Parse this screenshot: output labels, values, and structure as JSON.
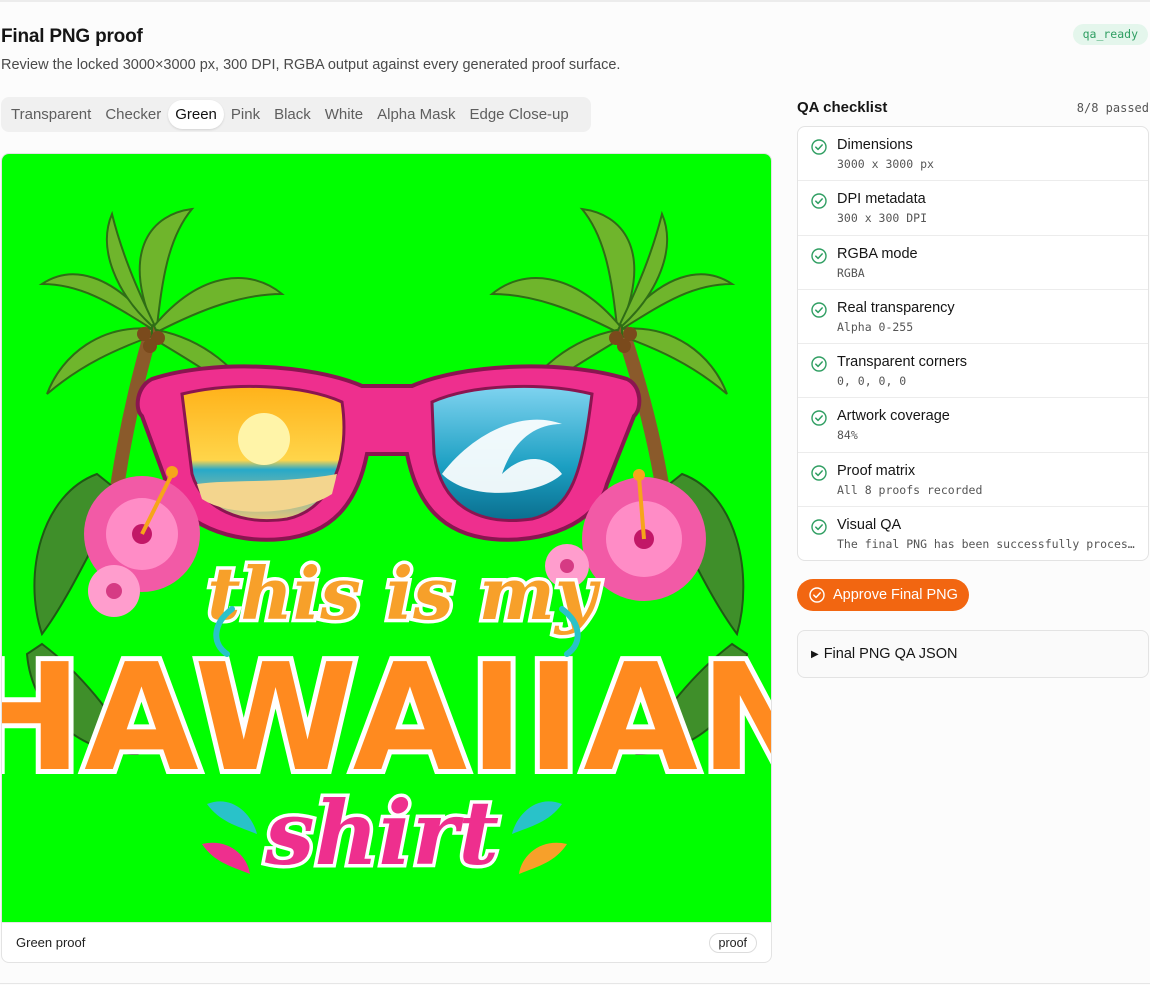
{
  "header": {
    "title": "Final PNG proof",
    "subtitle": "Review the locked 3000×3000 px, 300 DPI, RGBA output against every generated proof surface.",
    "status": "qa_ready"
  },
  "tabs": [
    "Transparent",
    "Checker",
    "Green",
    "Pink",
    "Black",
    "White",
    "Alpha Mask",
    "Edge Close-up"
  ],
  "active_tab": "Green",
  "preview": {
    "background_color": "#00ff00",
    "artwork": {
      "line1": "this is my",
      "line2": "HAWAIIAN",
      "line3": "shirt"
    },
    "footer_label": "Green proof",
    "footer_tag": "proof"
  },
  "qa": {
    "title": "QA checklist",
    "count": "8/8 passed",
    "items": [
      {
        "label": "Dimensions",
        "detail": "3000 x 3000 px"
      },
      {
        "label": "DPI metadata",
        "detail": "300 x 300 DPI"
      },
      {
        "label": "RGBA mode",
        "detail": "RGBA"
      },
      {
        "label": "Real transparency",
        "detail": "Alpha 0-255"
      },
      {
        "label": "Transparent corners",
        "detail": "0, 0, 0, 0"
      },
      {
        "label": "Artwork coverage",
        "detail": "84%"
      },
      {
        "label": "Proof matrix",
        "detail": "All 8 proofs recorded"
      },
      {
        "label": "Visual QA",
        "detail": "The final PNG has been successfully processed"
      }
    ]
  },
  "actions": {
    "approve_label": "Approve Final PNG",
    "json_label": "Final PNG QA JSON"
  },
  "colors": {
    "accent": "#f26611",
    "success": "#2f9e62",
    "proof_green": "#00ff00"
  }
}
